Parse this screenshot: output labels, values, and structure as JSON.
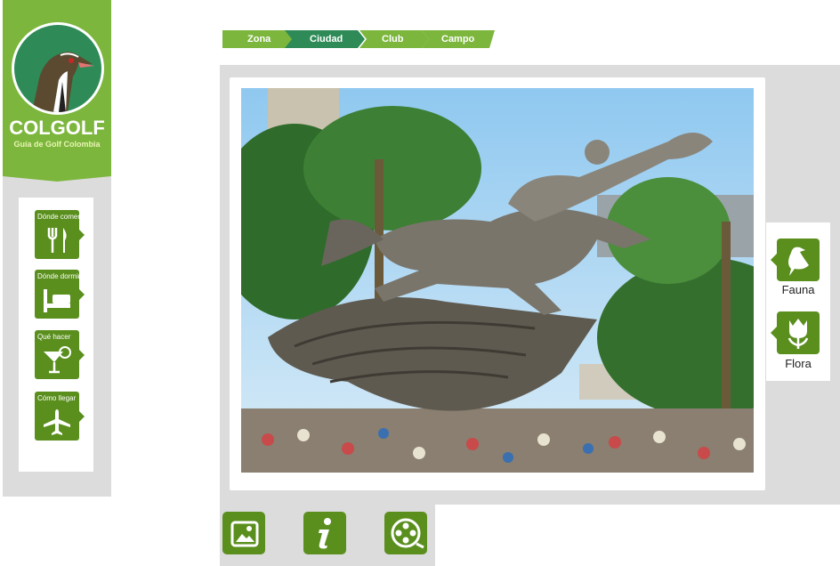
{
  "logo": {
    "title": "COLGOLF",
    "subtitle": "Guía de Golf Colombia"
  },
  "sidebar": {
    "items": [
      {
        "label": "Dónde comer",
        "icon": "fork-knife-icon"
      },
      {
        "label": "Dónde dormir",
        "icon": "bed-icon"
      },
      {
        "label": "Qué hacer",
        "icon": "cocktail-icon"
      },
      {
        "label": "Cómo llegar",
        "icon": "airplane-icon"
      }
    ]
  },
  "breadcrumb": {
    "items": [
      {
        "label": "Zona"
      },
      {
        "label": "Ciudad"
      },
      {
        "label": "Club"
      },
      {
        "label": "Campo"
      }
    ]
  },
  "side_tabs": {
    "items": [
      {
        "label": "Fauna",
        "icon": "bird-icon"
      },
      {
        "label": "Flora",
        "icon": "tulip-icon"
      }
    ]
  },
  "bottom_buttons": [
    {
      "icon": "gallery-icon"
    },
    {
      "icon": "info-icon"
    },
    {
      "icon": "video-reel-icon"
    }
  ],
  "colors": {
    "brand_green": "#7cb63d",
    "dark_green": "#5a8f1e",
    "teal_green": "#2e8b57",
    "panel_gray": "#dcdcdc"
  }
}
